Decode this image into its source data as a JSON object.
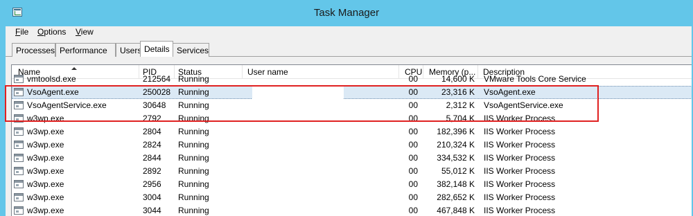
{
  "window": {
    "title": "Task Manager",
    "icon": "task-manager-icon"
  },
  "menu": [
    {
      "key": "F",
      "rest": "ile"
    },
    {
      "key": "O",
      "rest": "ptions"
    },
    {
      "key": "V",
      "rest": "iew"
    }
  ],
  "tabs": [
    "Processes",
    "Performance",
    "Users",
    "Details",
    "Services"
  ],
  "active_tab": "Details",
  "columns": [
    "Name",
    "PID",
    "Status",
    "User name",
    "CPU",
    "Memory (p...",
    "Description"
  ],
  "rows": [
    {
      "name": "vmtoolsd.exe",
      "pid": "212564",
      "status": "Running",
      "user": "",
      "cpu": "00",
      "mem": "14,600 K",
      "desc": "VMware Tools Core Service"
    },
    {
      "name": "VsoAgent.exe",
      "pid": "250028",
      "status": "Running",
      "user": "",
      "cpu": "00",
      "mem": "23,316 K",
      "desc": "VsoAgent.exe"
    },
    {
      "name": "VsoAgentService.exe",
      "pid": "30648",
      "status": "Running",
      "user": "",
      "cpu": "00",
      "mem": "2,312 K",
      "desc": "VsoAgentService.exe"
    },
    {
      "name": "w3wp.exe",
      "pid": "2792",
      "status": "Running",
      "user": "",
      "cpu": "00",
      "mem": "5,704 K",
      "desc": "IIS Worker Process"
    },
    {
      "name": "w3wp.exe",
      "pid": "2804",
      "status": "Running",
      "user": "",
      "cpu": "00",
      "mem": "182,396 K",
      "desc": "IIS Worker Process"
    },
    {
      "name": "w3wp.exe",
      "pid": "2824",
      "status": "Running",
      "user": "",
      "cpu": "00",
      "mem": "210,324 K",
      "desc": "IIS Worker Process"
    },
    {
      "name": "w3wp.exe",
      "pid": "2844",
      "status": "Running",
      "user": "",
      "cpu": "00",
      "mem": "334,532 K",
      "desc": "IIS Worker Process"
    },
    {
      "name": "w3wp.exe",
      "pid": "2892",
      "status": "Running",
      "user": "",
      "cpu": "00",
      "mem": "55,012 K",
      "desc": "IIS Worker Process"
    },
    {
      "name": "w3wp.exe",
      "pid": "2956",
      "status": "Running",
      "user": "",
      "cpu": "00",
      "mem": "382,148 K",
      "desc": "IIS Worker Process"
    },
    {
      "name": "w3wp.exe",
      "pid": "3004",
      "status": "Running",
      "user": "",
      "cpu": "00",
      "mem": "282,652 K",
      "desc": "IIS Worker Process"
    },
    {
      "name": "w3wp.exe",
      "pid": "3044",
      "status": "Running",
      "user": "",
      "cpu": "00",
      "mem": "467,848 K",
      "desc": "IIS Worker Process"
    }
  ],
  "selected_row": 1,
  "colors": {
    "titlebar": "#63c6e9",
    "selection": "#dbe9f5",
    "highlight": "#e02020"
  }
}
